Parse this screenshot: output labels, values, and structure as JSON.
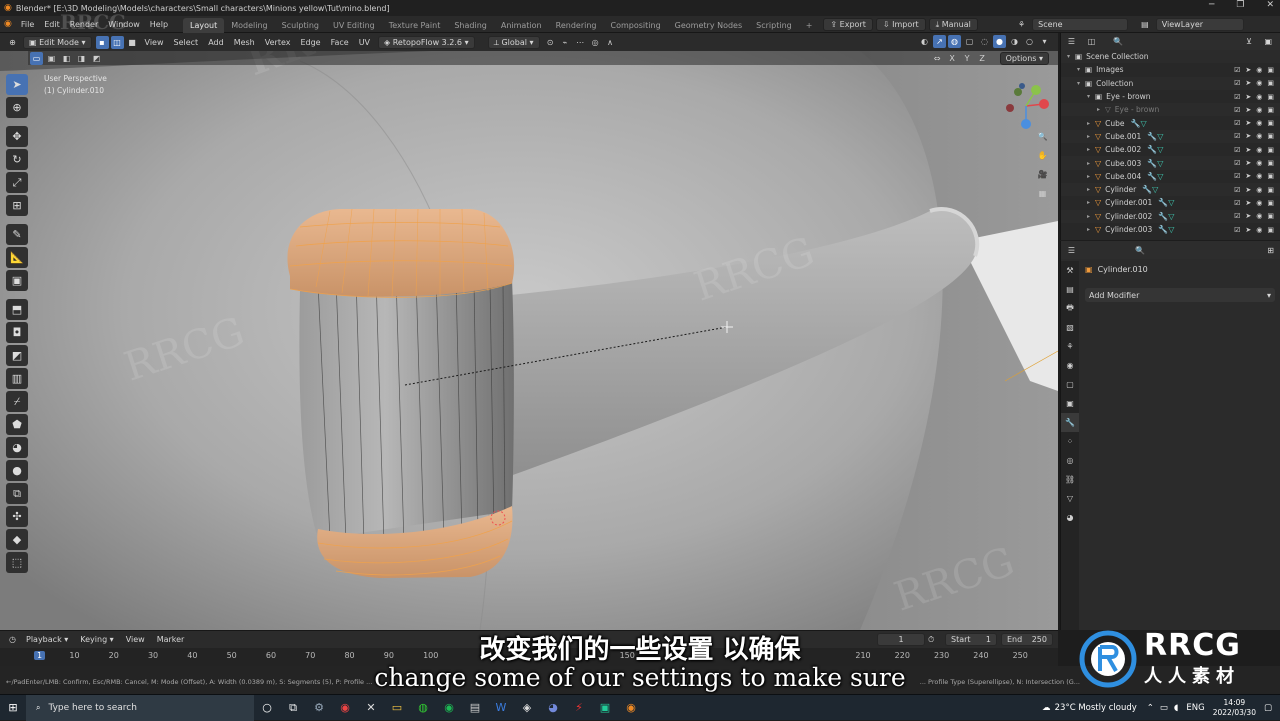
{
  "window": {
    "title": "Blender* [E:\\3D Modeling\\Models\\characters\\Small characters\\Minions yellow\\Tut\\mino.blend]"
  },
  "menu": {
    "items": [
      "File",
      "Edit",
      "Render",
      "Window",
      "Help"
    ],
    "workspaces": [
      "Layout",
      "Modeling",
      "Sculpting",
      "UV Editing",
      "Texture Paint",
      "Shading",
      "Animation",
      "Rendering",
      "Compositing",
      "Geometry Nodes",
      "Scripting"
    ],
    "active_workspace": "Layout",
    "add_tab": "+",
    "export_label": "Export",
    "import_label": "Import",
    "manual_label": "Manual",
    "scene_label": "Scene",
    "viewlayer_label": "ViewLayer"
  },
  "view_header": {
    "mode": "Edit Mode",
    "menus": [
      "View",
      "Select",
      "Add",
      "Mesh",
      "Vertex",
      "Edge",
      "Face",
      "UV"
    ],
    "addon": "RetopoFlow 3.2.6",
    "orientation": "Global",
    "options_label": "Options",
    "axes": [
      "X",
      "Y",
      "Z"
    ]
  },
  "viewport": {
    "perspective": "User Perspective",
    "object": "(1) Cylinder.010"
  },
  "outliner": {
    "rows": [
      {
        "name": "Scene Collection",
        "indent": 0,
        "type": "collection"
      },
      {
        "name": "Images",
        "indent": 1,
        "type": "collection"
      },
      {
        "name": "Collection",
        "indent": 1,
        "type": "collection"
      },
      {
        "name": "Eye - brown",
        "indent": 2,
        "type": "collection"
      },
      {
        "name": "Eye - brown",
        "indent": 3,
        "type": "mesh-hidden"
      },
      {
        "name": "Cube",
        "indent": 2,
        "type": "mesh"
      },
      {
        "name": "Cube.001",
        "indent": 2,
        "type": "mesh"
      },
      {
        "name": "Cube.002",
        "indent": 2,
        "type": "mesh"
      },
      {
        "name": "Cube.003",
        "indent": 2,
        "type": "mesh"
      },
      {
        "name": "Cube.004",
        "indent": 2,
        "type": "mesh"
      },
      {
        "name": "Cylinder",
        "indent": 2,
        "type": "mesh"
      },
      {
        "name": "Cylinder.001",
        "indent": 2,
        "type": "mesh"
      },
      {
        "name": "Cylinder.002",
        "indent": 2,
        "type": "mesh"
      },
      {
        "name": "Cylinder.003",
        "indent": 2,
        "type": "mesh"
      }
    ]
  },
  "properties": {
    "object_name": "Cylinder.010",
    "add_modifier_label": "Add Modifier"
  },
  "timeline": {
    "menus": [
      "Playback",
      "Keying",
      "View",
      "Marker"
    ],
    "current_frame": "1",
    "start_label": "Start",
    "start_value": "1",
    "end_label": "End",
    "end_value": "250",
    "ticks": [
      "1",
      "10",
      "20",
      "30",
      "40",
      "50",
      "60",
      "70",
      "80",
      "90",
      "100",
      "150",
      "210",
      "220",
      "230",
      "240",
      "250"
    ]
  },
  "status_bar": {
    "left": "←/PadEnter/LMB: Confirm, Esc/RMB: Cancel, M: Mode (Offset), A: Width (0.0389 m), S: Segments (5), P: Profile ...",
    "right": "... Profile Type (Superellipse), N: Intersection (G..."
  },
  "taskbar": {
    "search_placeholder": "Type here to search",
    "weather": "23°C  Mostly cloudy",
    "lang": "ENG",
    "time": "14:09",
    "date": "2022/03/30"
  },
  "subtitles": {
    "cn": "改变我们的一些设置 以确保",
    "en": "change some of our settings to make sure"
  },
  "watermark": {
    "brand": "RRCG",
    "cn": "人人素材",
    "corner_top": "RRCG"
  },
  "colors": {
    "accent": "#4772b3",
    "selection_orange": "#f0a24b",
    "mesh_icon": "#f09b3c",
    "modifier_icon": "#3fc7b0"
  }
}
